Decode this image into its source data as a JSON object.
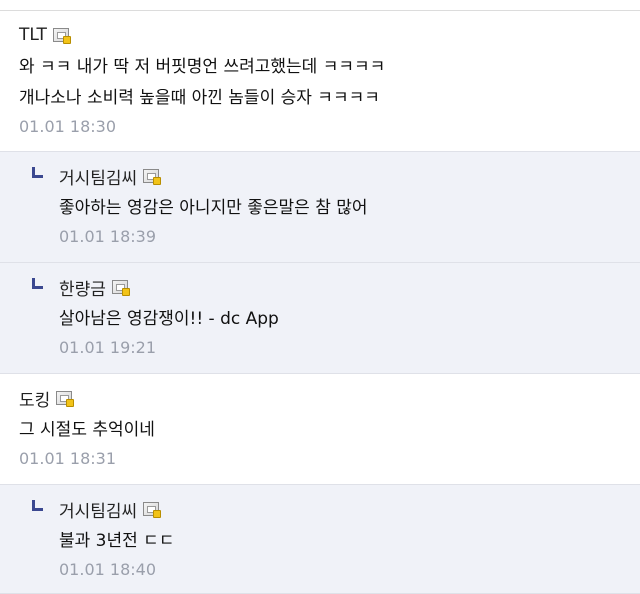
{
  "comments": [
    {
      "type": "comment",
      "nickname": "TLT",
      "badge_icon": "gallery-badge-icon",
      "lines": [
        "와 ㅋㅋ 내가 딱 저 버핏명언 쓰려고했는데 ㅋㅋㅋㅋ",
        "개나소나 소비력 높을때 아낀 놈들이 승자 ㅋㅋㅋㅋ"
      ],
      "time": "01.01 18:30"
    },
    {
      "type": "reply",
      "nickname": "거시팀김씨",
      "badge_icon": "gallery-badge-icon",
      "lines": [
        "좋아하는 영감은 아니지만 좋은말은 참 많어"
      ],
      "time": "01.01 18:39"
    },
    {
      "type": "reply",
      "nickname": "한량금",
      "badge_icon": "gallery-badge-icon",
      "lines": [
        "살아남은 영감쟁이!! - dc App"
      ],
      "time": "01.01 19:21"
    },
    {
      "type": "comment",
      "nickname": "도킹",
      "badge_icon": "gallery-badge-icon",
      "lines": [
        "그 시절도 추억이네"
      ],
      "time": "01.01 18:31"
    },
    {
      "type": "reply",
      "nickname": "거시팀김씨",
      "badge_icon": "gallery-badge-icon",
      "lines": [
        "불과 3년전 ㄷㄷ"
      ],
      "time": "01.01 18:40"
    }
  ]
}
